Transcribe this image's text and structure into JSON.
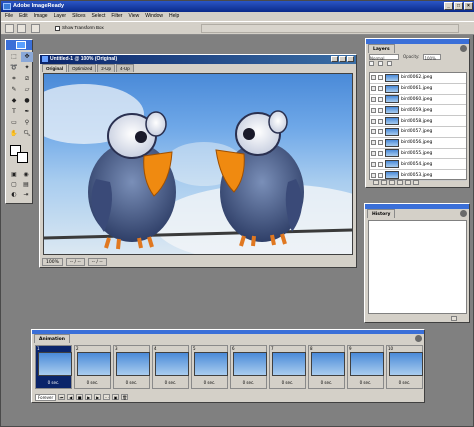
{
  "app": {
    "title": "Adobe ImageReady",
    "window_buttons": [
      "_",
      "□",
      "×"
    ]
  },
  "menubar": [
    "File",
    "Edit",
    "Image",
    "Layer",
    "Slices",
    "Select",
    "Filter",
    "View",
    "Window",
    "Help"
  ],
  "options_bar": {
    "show_transform_box_label": "Show Transform Box"
  },
  "document": {
    "title": "Untitled-1 @ 100% (Original)",
    "tabs": [
      "Original",
      "Optimized",
      "2-Up",
      "4-Up"
    ],
    "status": [
      "100%",
      "-- / --",
      "-- / --"
    ]
  },
  "layers_palette": {
    "tab": "Layers",
    "blend_mode": "Normal",
    "opacity_label": "Opacity:",
    "opacity": "100%",
    "layers": [
      "bird0062.jpeg",
      "bird0061.jpeg",
      "bird0060.jpeg",
      "bird0059.jpeg",
      "bird0058.jpeg",
      "bird0057.jpeg",
      "bird0056.jpeg",
      "bird0055.jpeg",
      "bird0054.jpeg",
      "bird0053.jpeg"
    ]
  },
  "history_palette": {
    "tab": "History"
  },
  "animation_palette": {
    "tab": "Animation",
    "loop": "Forever",
    "frames": [
      {
        "num": "1",
        "delay": "0 sec."
      },
      {
        "num": "2",
        "delay": "0 sec."
      },
      {
        "num": "3",
        "delay": "0 sec."
      },
      {
        "num": "4",
        "delay": "0 sec."
      },
      {
        "num": "5",
        "delay": "0 sec."
      },
      {
        "num": "6",
        "delay": "0 sec."
      },
      {
        "num": "7",
        "delay": "0 sec."
      },
      {
        "num": "8",
        "delay": "0 sec."
      },
      {
        "num": "9",
        "delay": "0 sec."
      },
      {
        "num": "10",
        "delay": "0 sec."
      }
    ]
  },
  "colors": {
    "title_blue": "#0a246a",
    "chrome": "#d4d0c8",
    "workspace": "#808080"
  }
}
